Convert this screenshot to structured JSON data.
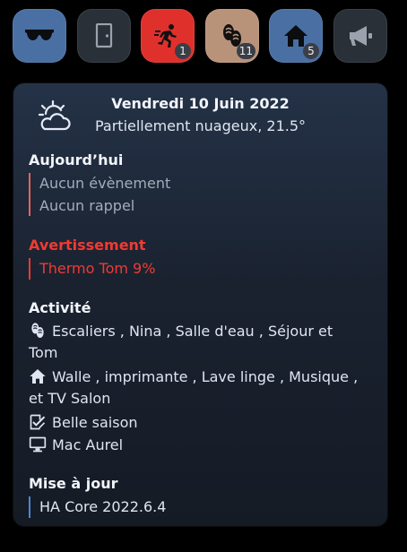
{
  "buttons": [
    {
      "icon": "sunglasses-icon",
      "color": "#4a6fa3",
      "badge": ""
    },
    {
      "icon": "door-icon",
      "color": "#2a3038",
      "badge": ""
    },
    {
      "icon": "running-person-icon",
      "color": "#e0302c",
      "badge": "1"
    },
    {
      "icon": "footprints-icon",
      "color": "#b8937a",
      "badge": "11"
    },
    {
      "icon": "home-icon",
      "color": "#4a6fa3",
      "badge": "5"
    },
    {
      "icon": "megaphone-icon",
      "color": "#2a3038",
      "badge": ""
    }
  ],
  "card": {
    "date": "Vendredi 10 Juin 2022",
    "weather": "Partiellement nuageux, 21.5°",
    "today": {
      "title": "Aujourd’hui",
      "items": [
        "Aucun évènement",
        "Aucun rappel"
      ],
      "bar_color": "#e9645a"
    },
    "warning": {
      "title": "Avertissement",
      "items": [
        "Thermo Tom 9%"
      ],
      "color": "#ef3b32"
    },
    "activity": {
      "title": "Activité",
      "items": [
        {
          "icon": "footprints-icon",
          "text_l1": "Escaliers , Nina , Salle d'eau , Séjour et",
          "text_l2": "Tom"
        },
        {
          "icon": "home-icon",
          "text_l1": "Walle , imprimante , Lave linge , Musique ,",
          "text_l2": "et TV Salon"
        },
        {
          "icon": "checklist-icon",
          "text_l1": "Belle saison",
          "text_l2": ""
        },
        {
          "icon": "monitor-icon",
          "text_l1": "Mac Aurel",
          "text_l2": ""
        }
      ]
    },
    "update": {
      "title": "Mise à jour",
      "items": [
        "HA Core 2022.6.4"
      ],
      "bar_color": "#4a86d8"
    }
  }
}
